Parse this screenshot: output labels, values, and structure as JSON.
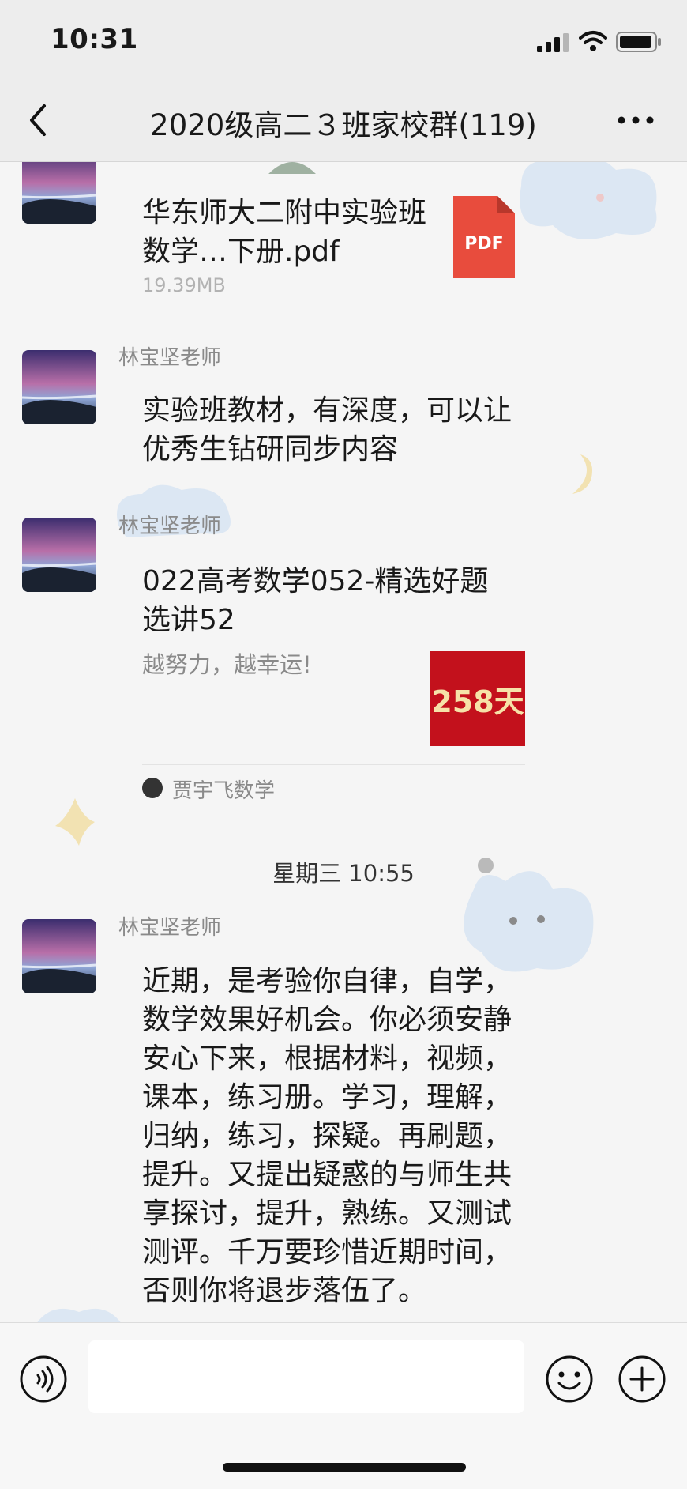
{
  "status_bar": {
    "time": "10:31"
  },
  "nav": {
    "title": "2020级高二３班家校群(119)"
  },
  "messages": {
    "file": {
      "name": "华东师大二附中实验班数学…下册.pdf",
      "size": "19.39MB",
      "file_badge": "PDF"
    },
    "text1": {
      "sender": "林宝坚老师",
      "lines": [
        "实验班教材，有深度，可以让",
        "优秀生钻研同步内容"
      ]
    },
    "card": {
      "sender": "林宝坚老师",
      "title": "022高考数学052-精选好题选讲52",
      "description": "越努力，越幸运!",
      "thumb_text": "258天",
      "source": "贾宇飞数学"
    },
    "date_stamp": "星期三 10:55",
    "text2": {
      "sender": "林宝坚老师",
      "lines": [
        "近期，是考验你自律，自学，",
        "数学效果好机会。你必须安静",
        "安心下来，根据材料，视频，",
        "课本，练习册。学习，理解，",
        "归纳，练习，探疑。再刷题，",
        "提升。又提出疑惑的与师生共",
        "享探讨，提升，熟练。又测试",
        "测评。千万要珍惜近期时间，",
        "否则你将退步落伍了。"
      ]
    }
  },
  "input_bar": {
    "placeholder": ""
  },
  "icons": {
    "back": "chevron-left-icon",
    "more": "more-dots-icon",
    "voice": "voice-icon",
    "emoji": "emoji-icon",
    "plus": "plus-icon"
  },
  "colors": {
    "pdf_badge": "#e84c3d",
    "thumb_bg": "#c3111c"
  }
}
